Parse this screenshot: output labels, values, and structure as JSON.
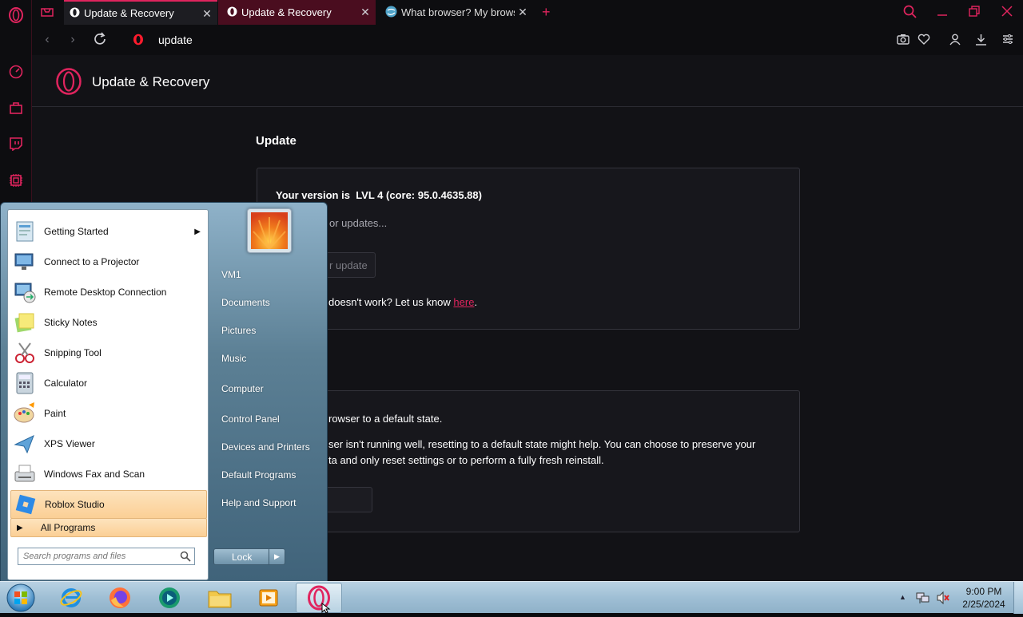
{
  "tabs": [
    {
      "title": "Update & Recovery",
      "close": "✕"
    },
    {
      "title": "Update & Recovery",
      "close": "✕"
    },
    {
      "title": "What browser? My browser",
      "close": "✕"
    }
  ],
  "new_tab": "+",
  "address": {
    "text": "update"
  },
  "page": {
    "header_title": "Update & Recovery",
    "update": {
      "section_title": "Update",
      "version_label": "Your version is",
      "version_value": "LVL 4 (core: 95.0.4635.88)",
      "checking": "or updates...",
      "button": "r update",
      "feedback_prefix": "doesn't work? Let us know",
      "feedback_link": "here",
      "feedback_suffix": "."
    },
    "recovery": {
      "line1": "rowser to a default state.",
      "line2": "ser isn't running well, resetting to a default state might help. You can choose to preserve your",
      "line3": "ta and only reset settings or to perform a fully fresh reinstall."
    }
  },
  "startmenu": {
    "programs": [
      {
        "label": "Getting Started",
        "icon": "getting-started-icon",
        "arrow": "▶"
      },
      {
        "label": "Connect to a Projector",
        "icon": "projector-icon"
      },
      {
        "label": "Remote Desktop Connection",
        "icon": "remote-desktop-icon"
      },
      {
        "label": "Sticky Notes",
        "icon": "sticky-notes-icon"
      },
      {
        "label": "Snipping Tool",
        "icon": "snipping-tool-icon"
      },
      {
        "label": "Calculator",
        "icon": "calculator-icon"
      },
      {
        "label": "Paint",
        "icon": "paint-icon"
      },
      {
        "label": "XPS Viewer",
        "icon": "xps-viewer-icon"
      },
      {
        "label": "Windows Fax and Scan",
        "icon": "fax-scan-icon"
      },
      {
        "label": "Roblox Studio",
        "icon": "roblox-studio-icon"
      }
    ],
    "all_programs": "All Programs",
    "search_placeholder": "Search programs and files",
    "right": [
      "VM1",
      "Documents",
      "Pictures",
      "Music",
      "Computer",
      "Control Panel",
      "Devices and Printers",
      "Default Programs",
      "Help and Support"
    ],
    "lock": "Lock"
  },
  "taskbar": {
    "time": "9:00 PM",
    "date": "2/25/2024"
  },
  "colors": {
    "accent": "#e0245e",
    "opera_red": "#ff1b2d",
    "highlight": "#fbd7a8"
  }
}
